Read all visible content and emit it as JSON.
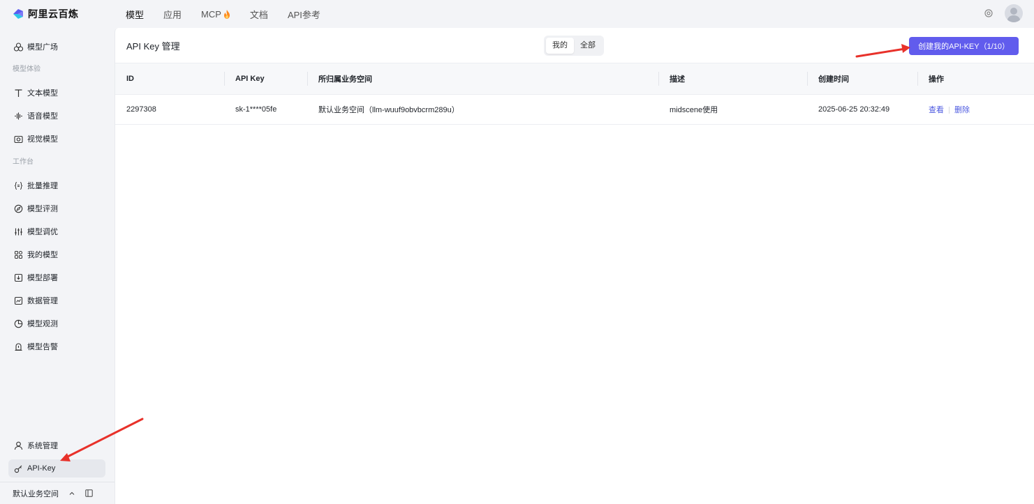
{
  "brand": {
    "name": "阿里云百炼"
  },
  "nav": {
    "items": [
      {
        "label": "模型",
        "active": true
      },
      {
        "label": "应用",
        "active": false
      },
      {
        "label": "MCP",
        "active": false,
        "icon": "fire-icon"
      },
      {
        "label": "文档",
        "active": false
      },
      {
        "label": "API参考",
        "active": false
      }
    ]
  },
  "sidebar": {
    "top_item": {
      "label": "模型广场",
      "icon": "cube-icon"
    },
    "section_trial": "模型体验",
    "trial_items": [
      {
        "label": "文本模型",
        "icon": "text-icon"
      },
      {
        "label": "语音模型",
        "icon": "waveform-icon"
      },
      {
        "label": "视觉模型",
        "icon": "camera-icon"
      }
    ],
    "section_workbench": "工作台",
    "workbench_items": [
      {
        "label": "批量推理",
        "icon": "braces-icon"
      },
      {
        "label": "模型评测",
        "icon": "compass-icon"
      },
      {
        "label": "模型调优",
        "icon": "sliders-icon"
      },
      {
        "label": "我的模型",
        "icon": "apps-icon"
      },
      {
        "label": "模型部署",
        "icon": "deploy-icon"
      },
      {
        "label": "数据管理",
        "icon": "chart-icon"
      },
      {
        "label": "模型观测",
        "icon": "pie-icon"
      },
      {
        "label": "模型告警",
        "icon": "alarm-icon"
      }
    ],
    "bottom_items": [
      {
        "label": "系统管理",
        "icon": "user-icon"
      },
      {
        "label": "API-Key",
        "icon": "key-icon",
        "active": true
      }
    ],
    "workspace": "默认业务空间"
  },
  "main": {
    "title": "API Key 管理",
    "segment": {
      "options": [
        "我的",
        "全部"
      ],
      "selected": "我的"
    },
    "create_button": "创建我的API-KEY（1/10）",
    "table": {
      "columns": [
        "ID",
        "API Key",
        "所归属业务空间",
        "描述",
        "创建时间",
        "操作"
      ],
      "rows": [
        {
          "id": "2297308",
          "key": "sk-1****05fe",
          "workspace": "默认业务空间（llm-wuuf9obvbcrm289u）",
          "desc": "midscene使用",
          "created": "2025-06-25 20:32:49",
          "actions": [
            "查看",
            "删除"
          ]
        }
      ]
    }
  },
  "colors": {
    "accent": "#615ced",
    "link": "#4c59e0",
    "annotation": "#e8312a"
  }
}
